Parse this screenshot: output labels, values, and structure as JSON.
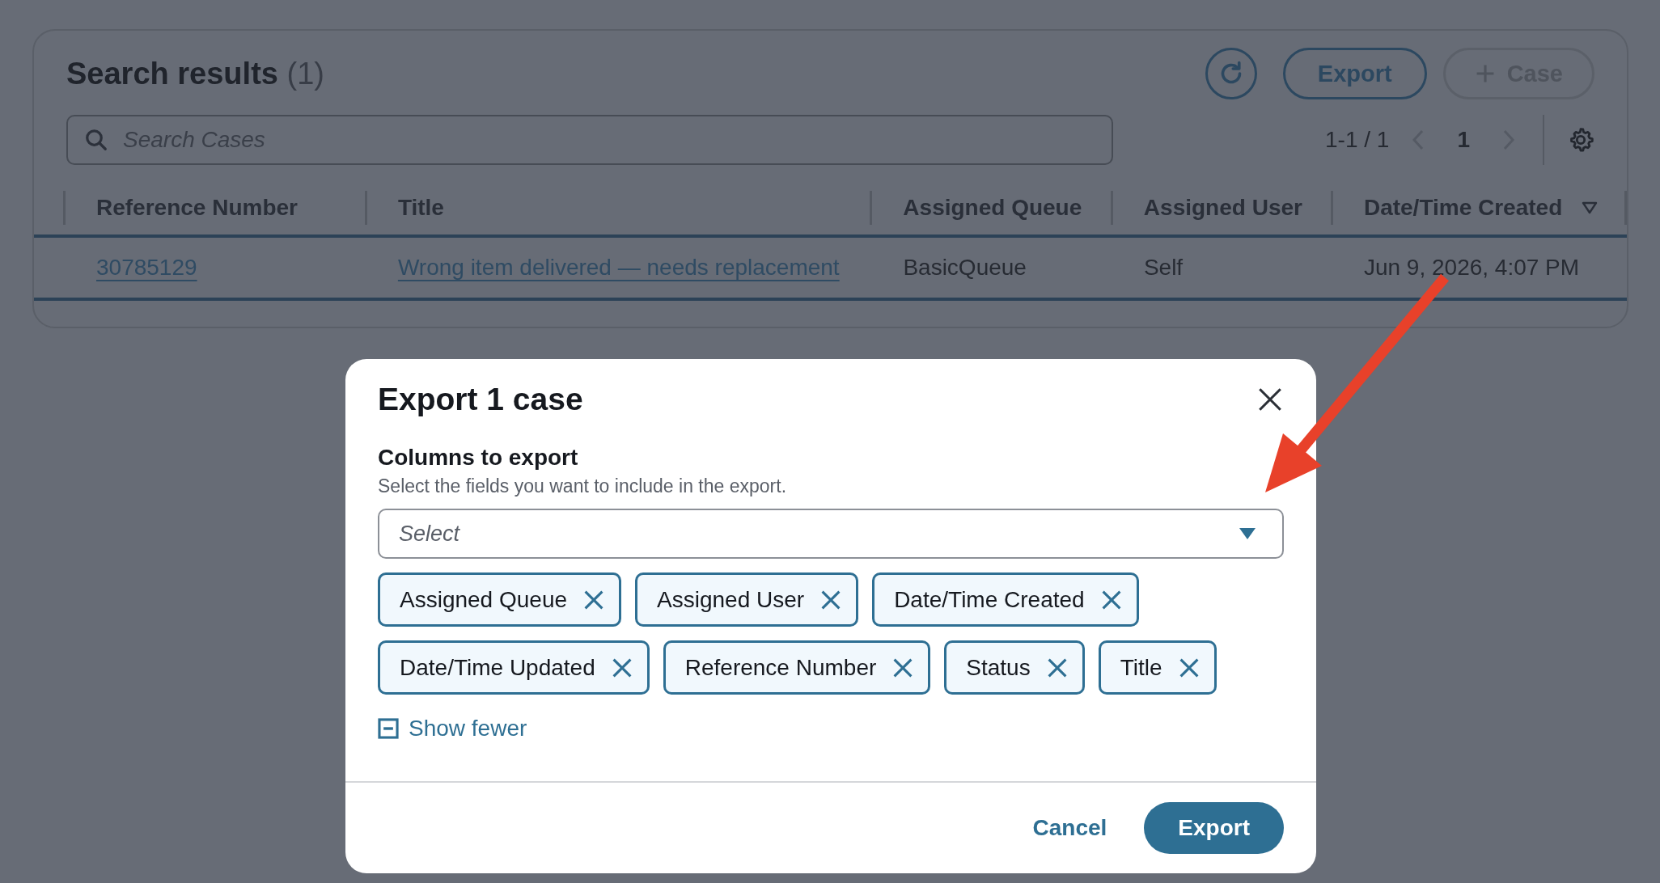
{
  "search_results": {
    "title": "Search results",
    "count": "(1)",
    "actions": [
      {
        "kind": "refresh",
        "disabled": false
      },
      {
        "kind": "text",
        "label": "Export",
        "disabled": false
      },
      {
        "kind": "add",
        "label": "Case",
        "disabled": true
      }
    ],
    "search": {
      "placeholder": "Search Cases"
    },
    "pagination": {
      "range": "1-1 / 1",
      "page": "1"
    },
    "table": {
      "columns": [
        {
          "label": "Reference Number",
          "sorted": false
        },
        {
          "label": "Title",
          "sorted": false
        },
        {
          "label": "Assigned Queue",
          "sorted": false
        },
        {
          "label": "Assigned User",
          "sorted": false
        },
        {
          "label": "Date/Time Created",
          "sorted": true
        }
      ],
      "rows": [
        {
          "cells": [
            {
              "text": "30785129",
              "kind": "link"
            },
            {
              "text": "Wrong item delivered — needs replacement",
              "kind": "link"
            },
            {
              "text": "BasicQueue",
              "kind": "text"
            },
            {
              "text": "Self",
              "kind": "text"
            },
            {
              "text": "Jun 9, 2026, 4:07 PM",
              "kind": "text"
            }
          ]
        }
      ]
    }
  },
  "export_dialog": {
    "title": "Export 1 case",
    "field_label": "Columns to export",
    "description": "Select the fields you want to include in the export.",
    "select": {
      "placeholder": "Select"
    },
    "tags": [
      "Assigned Queue",
      "Assigned User",
      "Date/Time Created",
      "Date/Time Updated",
      "Reference Number",
      "Status",
      "Title"
    ],
    "show_fewer": "Show fewer",
    "buttons": [
      {
        "label": "Cancel",
        "kind": "secondary"
      },
      {
        "label": "Export",
        "kind": "primary"
      }
    ]
  }
}
